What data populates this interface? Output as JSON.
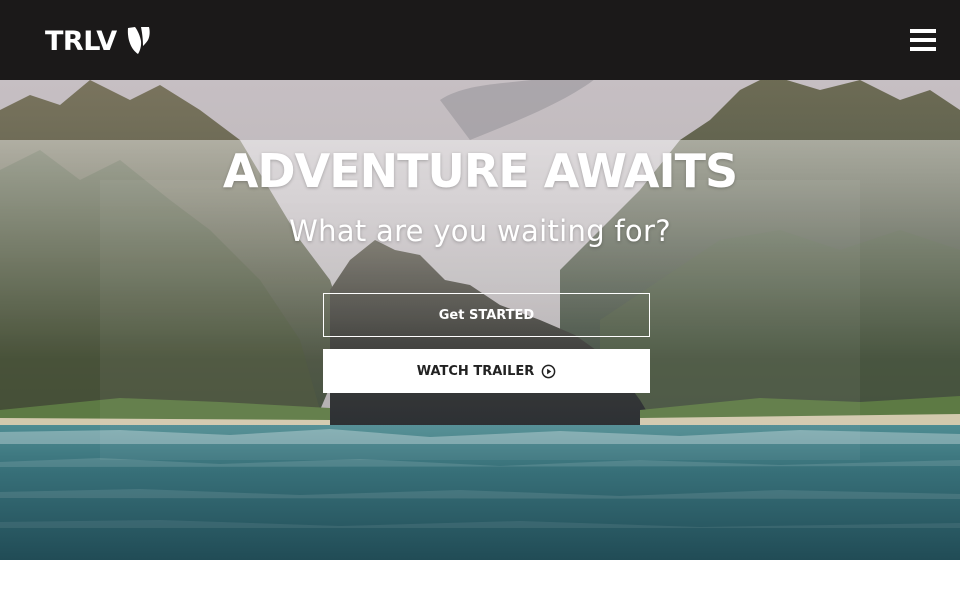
{
  "navbar": {
    "brand": "TRLV",
    "brand_logo_icon": "typo3-logo-icon",
    "menu_icon": "hamburger-menu-icon",
    "background_color": "#1b1919"
  },
  "hero": {
    "title": "ADVENTURE AWAITS",
    "subtitle": "What are you waiting for?",
    "get_started_label": "Get STARTED",
    "watch_trailer_label": "WATCH TRAILER",
    "play_icon": "play-circle-icon",
    "background_image": "coastal cliffs and ocean landscape"
  }
}
